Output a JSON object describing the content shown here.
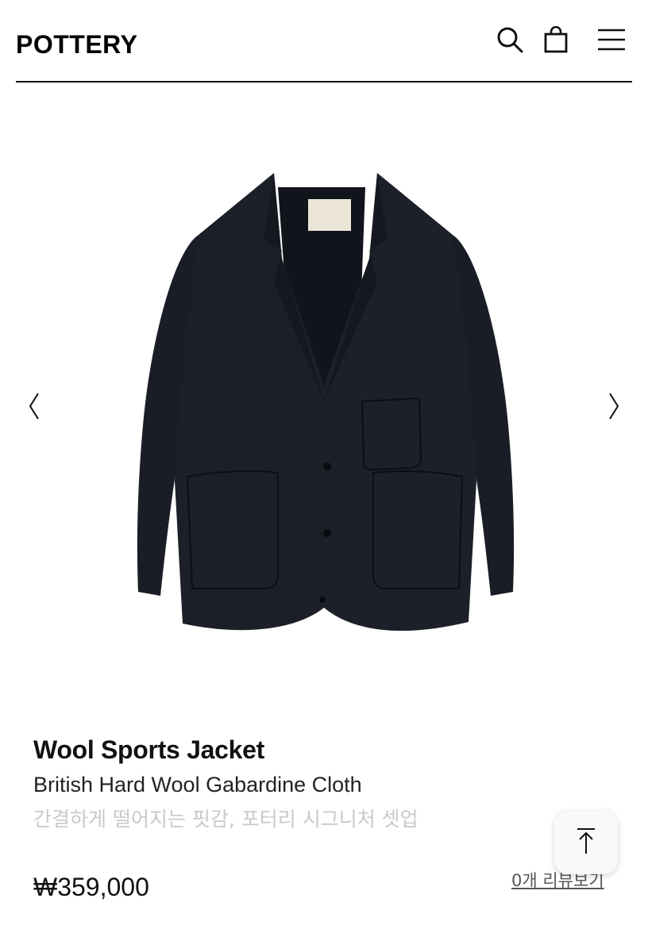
{
  "header": {
    "logo": "POTTERY",
    "icons": [
      "search-icon",
      "shopping-bag-icon",
      "hamburger-menu-icon"
    ]
  },
  "gallery": {
    "image_alt": "Wool Sports Jacket",
    "icons": [
      "chevron-left-icon",
      "chevron-right-icon"
    ]
  },
  "product": {
    "title": "Wool Sports Jacket",
    "subtitle": "British Hard Wool Gabardine Cloth",
    "description": "간결하게 떨어지는 핏감, 포터리 시그니처 셋업",
    "price": "₩359,000",
    "reviews_link": "0개 리뷰보기"
  },
  "floating": {
    "scroll_top_icon": "arrow-up-to-top-icon"
  },
  "colors": {
    "accent": "#111111",
    "jacket": "#1b1e26",
    "muted_text": "#c9c9c9"
  }
}
